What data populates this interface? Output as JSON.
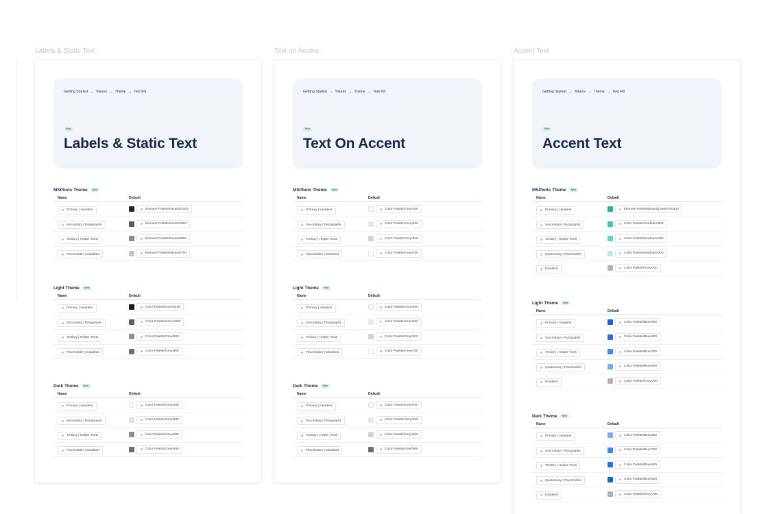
{
  "frames": [
    {
      "frame_label": "Labels & Static Text",
      "breadcrumb": [
        "Getting Started",
        "Tokens",
        "Theme",
        "Text Fill"
      ],
      "badge": "New",
      "title": "Labels & Static Text",
      "sections": [
        {
          "title": "MSPbots Theme",
          "badge": "New",
          "col_name": "Name",
          "col_default": "Default",
          "rows": [
            {
              "name": "Primary | Headers",
              "value": "Element Palette/Neutral/1000",
              "color": "#262626"
            },
            {
              "name": "Secondary | Paragraphs",
              "value": "Element Palette/Neutral/900",
              "color": "#5a5a5a"
            },
            {
              "name": "Tertiary | Helper Texts",
              "value": "Element Palette/Neutral/800",
              "color": "#8a8a8a"
            },
            {
              "name": "Placeholder | Disabled",
              "value": "Element Palette/Neutral/700",
              "color": "#c4c4c4"
            }
          ]
        },
        {
          "title": "Light Theme",
          "badge": "New",
          "col_name": "Name",
          "col_default": "Default",
          "rows": [
            {
              "name": "Primary | Headers",
              "value": "Color Palette/Grey/1100",
              "color": "#1a1a1a"
            },
            {
              "name": "Secondary | Paragraphs",
              "value": "Color Palette/Grey/1000",
              "color": "#5e5e5e"
            },
            {
              "name": "Tertiary | Helper Texts",
              "value": "Color Palette/Grey/800",
              "color": "#8e8e8e"
            },
            {
              "name": "Placeholder | Disabled",
              "value": "Color Palette/Grey/900",
              "color": "#6e6e6e"
            }
          ]
        },
        {
          "title": "Dark Theme",
          "badge": "New",
          "col_name": "Name",
          "col_default": "Default",
          "rows": [
            {
              "name": "Primary | Headers",
              "value": "Color Palette/Grey/200",
              "color": "#f7f7f7"
            },
            {
              "name": "Secondary | Paragraphs",
              "value": "Color Palette/Grey/500",
              "color": "#e4e4e4"
            },
            {
              "name": "Tertiary | Helper Texts",
              "value": "Color Palette/Grey/800",
              "color": "#8e8e8e"
            },
            {
              "name": "Placeholder | Disabled",
              "value": "Color Palette/Grey/900",
              "color": "#6e6e6e"
            }
          ]
        }
      ]
    },
    {
      "frame_label": "Text on Accent",
      "breadcrumb": [
        "Getting Started",
        "Tokens",
        "Theme",
        "Text Fill"
      ],
      "badge": "New",
      "title": "Text On Accent",
      "sections": [
        {
          "title": "MSPbots Theme",
          "badge": "New",
          "col_name": "Name",
          "col_default": "Default",
          "rows": [
            {
              "name": "Primary | Headers",
              "value": "Color Palette/Grey/200",
              "color": "#f7f7f7"
            },
            {
              "name": "Secondary | Paragraphs",
              "value": "Color Palette/Grey/500",
              "color": "#e7e7e7"
            },
            {
              "name": "Tertiary | Helper Texts",
              "value": "Color Palette/Grey/600",
              "color": "#d3d3d3"
            },
            {
              "name": "Placeholder | Disabled",
              "value": "Color Palette/Grey/100",
              "color": "#ffffff"
            }
          ]
        },
        {
          "title": "Light Theme",
          "badge": "New",
          "col_name": "Name",
          "col_default": "Default",
          "rows": [
            {
              "name": "Primary | Headers",
              "value": "Color Palette/Grey/200",
              "color": "#f7f7f7"
            },
            {
              "name": "Secondary | Paragraphs",
              "value": "Color Palette/Grey/500",
              "color": "#e7e7e7"
            },
            {
              "name": "Tertiary | Helper Texts",
              "value": "Color Palette/Grey/600",
              "color": "#d3d3d3"
            },
            {
              "name": "Placeholder | Disabled",
              "value": "Color Palette/Grey/100",
              "color": "#ffffff"
            }
          ]
        },
        {
          "title": "Dark Theme",
          "badge": "New",
          "col_name": "Name",
          "col_default": "Default",
          "rows": [
            {
              "name": "Primary | Headers",
              "value": "Color Palette/Grey/200",
              "color": "#f7f7f7"
            },
            {
              "name": "Secondary | Paragraphs",
              "value": "Color Palette/Grey/500",
              "color": "#e7e7e7"
            },
            {
              "name": "Tertiary | Helper Texts",
              "value": "Color Palette/Grey/600",
              "color": "#d3d3d3"
            },
            {
              "name": "Placeholder | Disabled",
              "value": "Color Palette/Grey/900",
              "color": "#6e6e6e"
            }
          ]
        }
      ]
    },
    {
      "frame_label": "Accent Text",
      "breadcrumb": [
        "Getting Started",
        "Tokens",
        "Theme",
        "Text Fill"
      ],
      "badge": "New",
      "title": "Accent Text",
      "sections": [
        {
          "title": "MSPbots Theme",
          "badge": "New",
          "col_name": "Name",
          "col_default": "Default",
          "rows": [
            {
              "name": "Primary | Headers",
              "value": "Element Palette/Brand/1000(Primary)",
              "color": "#1fb7a3"
            },
            {
              "name": "Secondary | Paragraphs",
              "value": "Color Palette/Seafoam/500",
              "color": "#3cc8b4"
            },
            {
              "name": "Tertiary | Helper Texts",
              "value": "Color Palette/Seafoam/400",
              "color": "#5dd6c6"
            },
            {
              "name": "Quaternary | Placeholder",
              "value": "Color Palette/Seafoam/200",
              "color": "#b6ede5"
            },
            {
              "name": "Disabled",
              "value": "Color Palette/Grey/700",
              "color": "#b3b3b3"
            }
          ]
        },
        {
          "title": "Light Theme",
          "badge": "New",
          "col_name": "Name",
          "col_default": "Default",
          "rows": [
            {
              "name": "Primary | Headers",
              "value": "Color Palette/Blue/900",
              "color": "#1565d8"
            },
            {
              "name": "Secondary | Paragraphs",
              "value": "Color Palette/Blue/800",
              "color": "#1f73e6"
            },
            {
              "name": "Tertiary | Helper Texts",
              "value": "Color Palette/Blue/700",
              "color": "#3a8aef"
            },
            {
              "name": "Quaternary | Placeholder",
              "value": "Color Palette/Blue/500",
              "color": "#6fb0f3"
            },
            {
              "name": "Disabled",
              "value": "Color Palette/Grey/700",
              "color": "#b3b3b3"
            }
          ]
        },
        {
          "title": "Dark Theme",
          "badge": "New",
          "col_name": "Name",
          "col_default": "Default",
          "rows": [
            {
              "name": "Primary | Headers",
              "value": "Color Palette/Blue/500",
              "color": "#6fb0f3"
            },
            {
              "name": "Secondary | Paragraphs",
              "value": "Color Palette/Blue/700",
              "color": "#3a8aef"
            },
            {
              "name": "Tertiary | Helper Texts",
              "value": "Color Palette/Blue/800",
              "color": "#1f73e6"
            },
            {
              "name": "Quaternary | Placeholder",
              "value": "Color Palette/Blue/900",
              "color": "#1565d8"
            },
            {
              "name": "Disabled",
              "value": "Color Palette/Grey/700",
              "color": "#b3b3b3"
            }
          ]
        }
      ]
    }
  ]
}
